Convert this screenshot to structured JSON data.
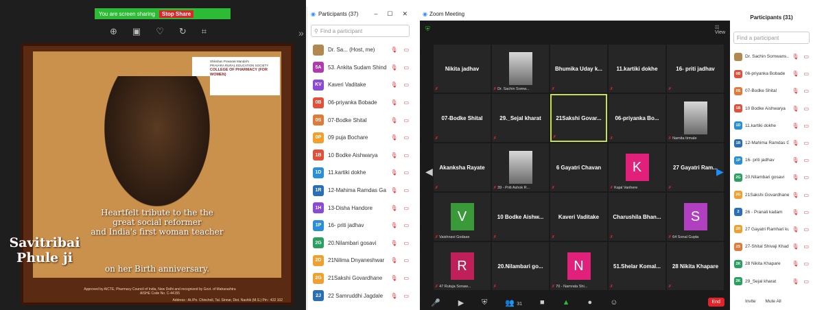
{
  "share": {
    "banner_text": "You are screen sharing",
    "stop_label": "Stop Share",
    "poster": {
      "college_lines": [
        "Shikshan Prasarak Mandal's",
        "PRAVARA RURAL EDUCATION SOCIETY"
      ],
      "college_name": "COLLEGE OF PHARMACY (FOR WOMEN)",
      "tribute_line1": "Heartfelt tribute to the the",
      "tribute_line2": "great social reformer",
      "tribute_line3": "and India's first woman teacher",
      "tribute_name": "Savitribai Phule ji",
      "tribute_line4": "on her Birth anniversary.",
      "approved": "Approved by AICTE, Pharmacy Council of India, New Delhi and recognized by Govt. of Maharashtra",
      "aishe": "AISHE Code No. C-44155",
      "address": "Address : At./Po. Chincholi, Tal. Sinnar, Dist. Nashik (M.S.) Pin : 422 102"
    }
  },
  "left_panel": {
    "title": "Participants (37)",
    "search_placeholder": "Find a participant",
    "participants": [
      {
        "initials": "",
        "name": "Dr. Sa... (Host, me)",
        "color": "#b08850"
      },
      {
        "initials": "5A",
        "name": "53. Ankita Sudam Shinde",
        "color": "#b23ab0"
      },
      {
        "initials": "KV",
        "name": "Kaveri Vaditake",
        "color": "#8a4ad6"
      },
      {
        "initials": "0B",
        "name": "06-priyanka Bobade",
        "color": "#e0503a"
      },
      {
        "initials": "0S",
        "name": "07-Bodke Shital",
        "color": "#e07a3a"
      },
      {
        "initials": "0P",
        "name": "09 puja Bochare",
        "color": "#f0a030"
      },
      {
        "initials": "1B",
        "name": "10 Bodke Aishwarya",
        "color": "#e0503a"
      },
      {
        "initials": "1D",
        "name": "11.kartiki dokhe",
        "color": "#2a8fd6"
      },
      {
        "initials": "1R",
        "name": "12-Mahima Ramdas Gawali",
        "color": "#2a6fb6"
      },
      {
        "initials": "1H",
        "name": "13-Disha Handore",
        "color": "#8a4ad6"
      },
      {
        "initials": "1P",
        "name": "16- priti jadhav",
        "color": "#2a8fd6"
      },
      {
        "initials": "2G",
        "name": "20.Nilambari gosavi",
        "color": "#2aa060"
      },
      {
        "initials": "2D",
        "name": "21Nilima Dnyaneshwar Go...",
        "color": "#f0a030"
      },
      {
        "initials": "2G",
        "name": "21Sakshi Govardhane",
        "color": "#f0a030"
      },
      {
        "initials": "2J",
        "name": "22 Samruddhi Jagdale",
        "color": "#2a6fb6"
      }
    ]
  },
  "meeting": {
    "title": "Zoom Meeting",
    "view_label": "View",
    "tiles": [
      {
        "name": "Nikita jadhav",
        "sub": ""
      },
      {
        "name": "",
        "sub": "Dr. Sachin Somw..."
      },
      {
        "name": "Bhumika Uday k...",
        "sub": ""
      },
      {
        "name": "11.kartiki dokhe",
        "sub": ""
      },
      {
        "name": "16- priti jadhav",
        "sub": ""
      },
      {
        "name": "07-Bodke Shital",
        "sub": ""
      },
      {
        "name": "29._Sejal kharat",
        "sub": ""
      },
      {
        "name": "21Sakshi Govar...",
        "sub": ""
      },
      {
        "name": "06-priyanka Bo...",
        "sub": ""
      },
      {
        "name": "",
        "sub": "Namita tirmale"
      },
      {
        "name": "Akanksha Rayate",
        "sub": ""
      },
      {
        "name": "",
        "sub": "39 - Priti Ashok R..."
      },
      {
        "name": "6 Gayatri Chavan",
        "sub": ""
      },
      {
        "name": "K",
        "sub": "Kajal Vanhere"
      },
      {
        "name": "27 Gayatri Ram...",
        "sub": ""
      },
      {
        "name": "V",
        "sub": "Vaishnavi Godase"
      },
      {
        "name": "10 Bodke Aishw...",
        "sub": ""
      },
      {
        "name": "Kaveri Vaditake",
        "sub": ""
      },
      {
        "name": "Charushila Bhan...",
        "sub": ""
      },
      {
        "name": "S",
        "sub": "64 Sonal Gupta"
      },
      {
        "name": "R",
        "sub": "47 Rutuja Sonaw..."
      },
      {
        "name": "20.Nilambari go...",
        "sub": ""
      },
      {
        "name": "N",
        "sub": "70 - Namrata Shi..."
      },
      {
        "name": "51.Shelar Komal...",
        "sub": ""
      },
      {
        "name": "28 Nikita Khapare",
        "sub": ""
      }
    ],
    "end_label": "End",
    "participant_count": "31"
  },
  "right_panel": {
    "title": "Participants (31)",
    "search_placeholder": "Find a participant",
    "participants": [
      {
        "initials": "",
        "name": "Dr. Sachin Somwans... (Host, me)",
        "color": "#b08850"
      },
      {
        "initials": "0B",
        "name": "06-priyanka Bobade",
        "color": "#e0503a"
      },
      {
        "initials": "0S",
        "name": "07-Bodke Shital",
        "color": "#e07a3a"
      },
      {
        "initials": "1B",
        "name": "10 Bodke Aishwarya",
        "color": "#e0503a"
      },
      {
        "initials": "1D",
        "name": "11.kartiki dokhe",
        "color": "#2a8fd6"
      },
      {
        "initials": "1R",
        "name": "12-Mahima Ramdas Gawali",
        "color": "#2a6fb6"
      },
      {
        "initials": "1P",
        "name": "16- priti jadhav",
        "color": "#2a8fd6"
      },
      {
        "initials": "2G",
        "name": "20.Nilambari gosavi",
        "color": "#2aa060"
      },
      {
        "initials": "2G",
        "name": "21Sakshi Govardhane",
        "color": "#f0a030"
      },
      {
        "initials": "2",
        "name": "26 - Pranali kadam",
        "color": "#2a6fb6"
      },
      {
        "initials": "2R",
        "name": "27 Gayatri Ramhari kunde",
        "color": "#f0a030"
      },
      {
        "initials": "2S",
        "name": "27-Shital Shivaji Khade",
        "color": "#e07a3a"
      },
      {
        "initials": "2K",
        "name": "28 Nikita Khapare",
        "color": "#2aa060"
      },
      {
        "initials": "2K",
        "name": "29_Sejal kharat",
        "color": "#2aa060"
      }
    ],
    "invite_label": "Invite",
    "mute_all_label": "Mute All"
  }
}
